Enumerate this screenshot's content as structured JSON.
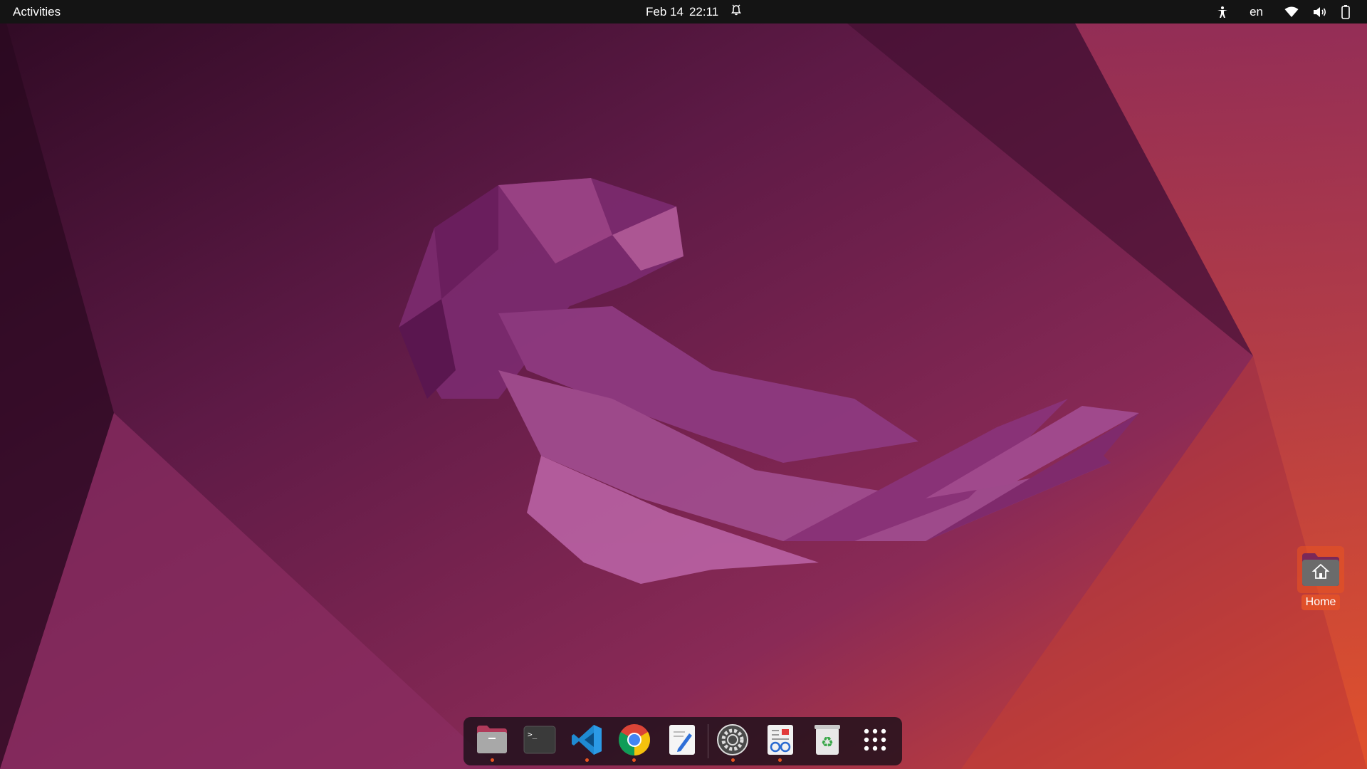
{
  "topbar": {
    "activities_label": "Activities",
    "date": "Feb 14",
    "time": "22:11",
    "icons": [
      "alarm-icon",
      "accessibility-icon",
      "wifi-icon",
      "volume-icon",
      "battery-icon"
    ],
    "language": "en"
  },
  "desktop": {
    "home_icon": {
      "label": "Home",
      "icon": "home-folder-icon"
    }
  },
  "dock": {
    "items": [
      {
        "name": "files",
        "icon": "files-icon",
        "running": true
      },
      {
        "name": "terminal",
        "icon": "terminal-icon",
        "running": false
      },
      {
        "name": "vscode",
        "icon": "vscode-icon",
        "running": true
      },
      {
        "name": "chrome",
        "icon": "chrome-icon",
        "running": true
      },
      {
        "name": "text-editor",
        "icon": "text-editor-icon",
        "running": false
      },
      {
        "name": "settings",
        "icon": "settings-icon",
        "running": true
      },
      {
        "name": "document-viewer",
        "icon": "document-viewer-icon",
        "running": true
      },
      {
        "name": "trash",
        "icon": "trash-icon",
        "running": false
      },
      {
        "name": "show-applications",
        "icon": "app-grid-icon",
        "running": false
      }
    ]
  },
  "colors": {
    "accent": "#e95420",
    "topbar": "#141414",
    "wallpaper_dark": "#3a0c2c",
    "wallpaper_mid": "#7a2457",
    "wallpaper_warm": "#d94a35"
  }
}
